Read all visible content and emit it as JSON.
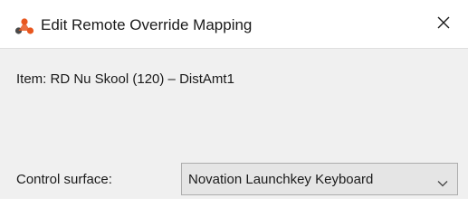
{
  "window": {
    "title": "Edit Remote Override Mapping",
    "app_icon": "triangle-logo-icon",
    "close_icon": "close-icon"
  },
  "item": {
    "text": "Item: RD Nu Skool (120) – DistAmt1"
  },
  "control_surface": {
    "label": "Control surface:",
    "selected": "Novation Launchkey Keyboard",
    "chevron_icon": "chevron-down-icon"
  },
  "colors": {
    "logo_orange": "#e8561e",
    "logo_dark": "#4a4a4a"
  }
}
